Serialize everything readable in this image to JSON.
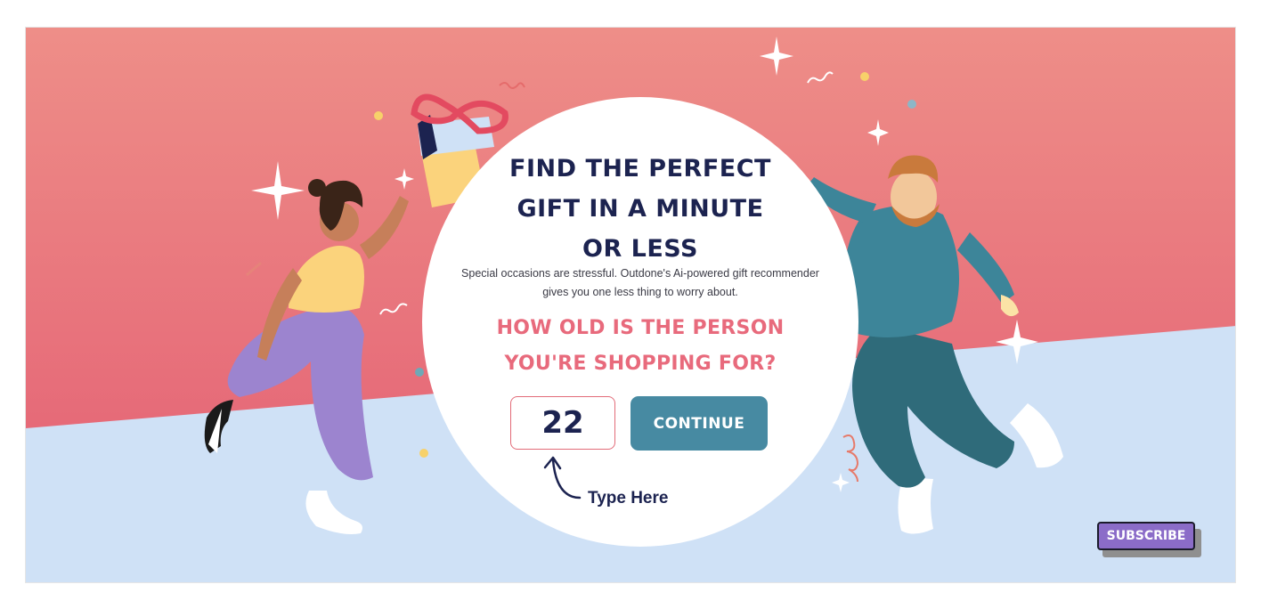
{
  "hero": {
    "headline": [
      "FIND THE PERFECT",
      "GIFT IN A MINUTE",
      "OR LESS"
    ],
    "subtitle": [
      "Special occasions are stressful. Outdone's Ai-powered gift recommender",
      "gives you one less thing to worry about."
    ],
    "question": [
      "HOW OLD IS THE PERSON",
      "YOU'RE SHOPPING FOR?"
    ],
    "age_value": "22",
    "continue_label": "CONTINUE",
    "hint_label": "Type Here"
  },
  "subscribe_label": "SUBSCRIBE",
  "colors": {
    "top_bg": "#e8747f",
    "bottom_bg": "#cde0f6",
    "headline": "#1c2350",
    "question": "#e86a7c",
    "button": "#478aa2",
    "subscribe": "#8b6cc8"
  },
  "icons": [
    "curved-arrow-icon",
    "sparkle-icon",
    "confetti-icon"
  ]
}
